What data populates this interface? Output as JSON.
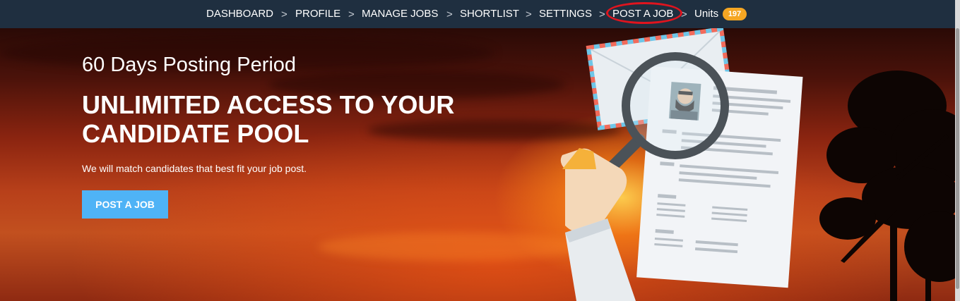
{
  "nav": {
    "items": [
      {
        "label": "DASHBOARD"
      },
      {
        "label": "PROFILE"
      },
      {
        "label": "MANAGE JOBS"
      },
      {
        "label": "SHORTLIST"
      },
      {
        "label": "SETTINGS"
      },
      {
        "label": "POST A JOB"
      },
      {
        "label": "Units",
        "badge": "197"
      }
    ],
    "separator": ">"
  },
  "hero": {
    "subtitle": "60 Days Posting Period",
    "title": "UNLIMITED ACCESS TO YOUR CANDIDATE POOL",
    "description": "We will match candidates that best fit your job post.",
    "cta_label": "POST A JOB"
  },
  "colors": {
    "nav_bg": "#1f2f40",
    "badge": "#f5a623",
    "cta": "#4fb3f6",
    "highlight": "#e0141e"
  }
}
